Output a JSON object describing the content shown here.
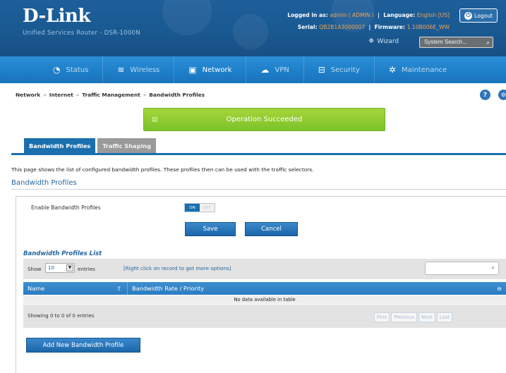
{
  "header": {
    "logo": "D-Link",
    "product": "Unified Services Router - DSR-1000N",
    "logged_in_label": "Logged in as:",
    "logged_in_value": "admin ( ADMIN )",
    "language_label": "Language:",
    "language_value": "English [US]",
    "serial_label": "Serial:",
    "serial_value": "QB2B1A3000007",
    "firmware_label": "Firmware:",
    "firmware_value": "1.10B006E_WW",
    "logout_label": "Logout",
    "wizard_label": "Wizard",
    "search_placeholder": "System Search..."
  },
  "nav": {
    "items": [
      {
        "label": "Status",
        "icon": "dashboard-icon"
      },
      {
        "label": "Wireless",
        "icon": "wifi-icon"
      },
      {
        "label": "Network",
        "icon": "monitor-icon"
      },
      {
        "label": "VPN",
        "icon": "cloud-lock-icon"
      },
      {
        "label": "Security",
        "icon": "lock-icon"
      },
      {
        "label": "Maintenance",
        "icon": "gear-icon"
      }
    ],
    "active": "Network"
  },
  "breadcrumb": [
    "Network",
    "Internet",
    "Traffic Management",
    "Bandwidth Profiles"
  ],
  "breadcrumb_sep": "»",
  "success_message": "Operation Succeeded",
  "tabs": [
    "Bandwidth Profiles",
    "Traffic Shaping"
  ],
  "description": "This page shows the list of configured bandwidth profiles. These profiles then can be used with the traffic selectors.",
  "section_title": "Bandwidth Profiles",
  "form": {
    "enable_label": "Enable Bandwidth Profiles",
    "toggle_on": "ON",
    "toggle_off": "OFF",
    "save_label": "Save",
    "cancel_label": "Cancel"
  },
  "list": {
    "title": "Bandwidth Profiles List",
    "show_label": "Show",
    "entries_value": "10",
    "entries_label": "entries",
    "hint": "[Right click on record to get more options]",
    "columns": [
      "Name",
      "Bandwidth Rate / Priority"
    ],
    "empty_text": "No data available in table",
    "showing_text": "Showing 0 to 0 of 0 entries",
    "pager": [
      "First",
      "Previous",
      "Next",
      "Last"
    ]
  },
  "add_button_label": "Add New Bandwidth Profile",
  "colors": {
    "accent": "#1a6fae",
    "success": "#7cc22a",
    "header_bg": "#1a5a93",
    "nav_bg": "#1d7ec8"
  }
}
